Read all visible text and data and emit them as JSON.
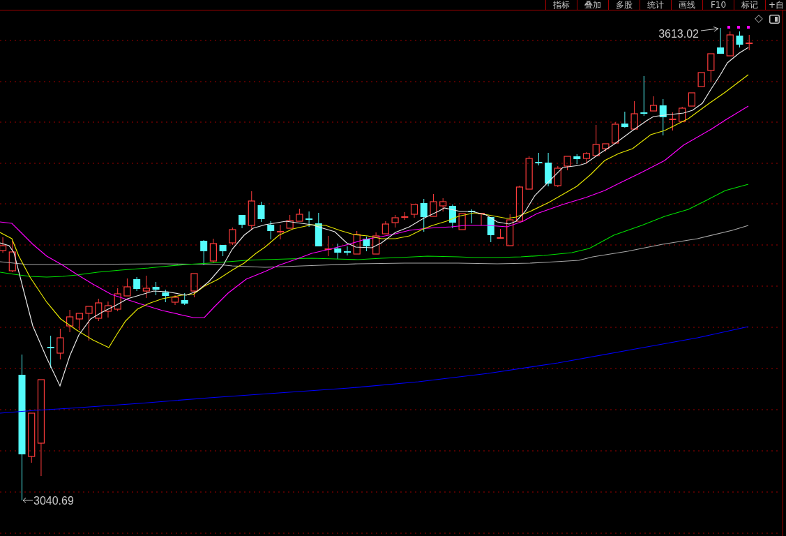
{
  "toolbar": {
    "buttons": [
      {
        "label": "指标"
      },
      {
        "label": "叠加"
      },
      {
        "label": "多股"
      },
      {
        "label": "统计"
      },
      {
        "label": "画线"
      },
      {
        "label": "F10"
      },
      {
        "label": "标记"
      },
      {
        "label": "+自"
      }
    ]
  },
  "chart": {
    "high_label": "3613.02",
    "low_label": "3040.69"
  }
}
